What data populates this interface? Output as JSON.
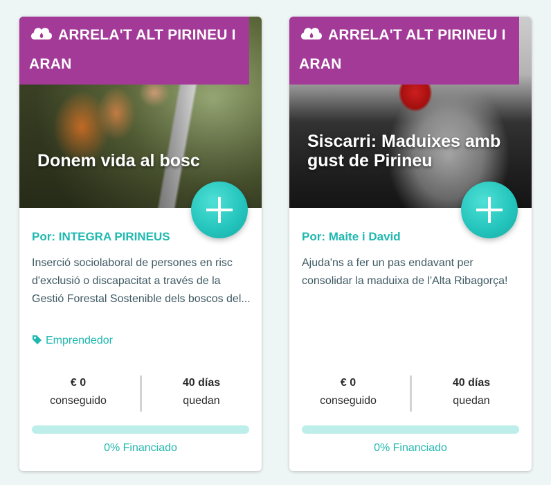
{
  "theme": {
    "accent": "#22c3bb",
    "banner": "#a33a98"
  },
  "cards": [
    {
      "banner": "ARRELA'T ALT PIRINEU I ARAN",
      "banner_icon": "cloud-drop-icon",
      "title": "Donem vida al bosc",
      "author": "Por: INTEGRA PIRINEUS",
      "description": "Inserció sociolaboral de persones en risc d'exclusió o discapacitat a través de la Gestió Forestal Sostenible dels boscos del...",
      "category": "Emprendedor",
      "raised_value": "€ 0",
      "raised_label": "conseguido",
      "days_value": "40 días",
      "days_label": "quedan",
      "progress_percent": 0,
      "progress_label": "0% Financiado"
    },
    {
      "banner": "ARRELA'T ALT PIRINEU I ARAN",
      "banner_icon": "cloud-drop-icon",
      "title": "Siscarri: Maduixes amb gust de Pirineu",
      "author": "Por: Maite i David",
      "description": "Ajuda'ns a fer un pas endavant per consolidar la maduixa de l'Alta Ribagorça!",
      "category": "",
      "raised_value": "€ 0",
      "raised_label": "conseguido",
      "days_value": "40 días",
      "days_label": "quedan",
      "progress_percent": 0,
      "progress_label": "0% Financiado"
    }
  ]
}
